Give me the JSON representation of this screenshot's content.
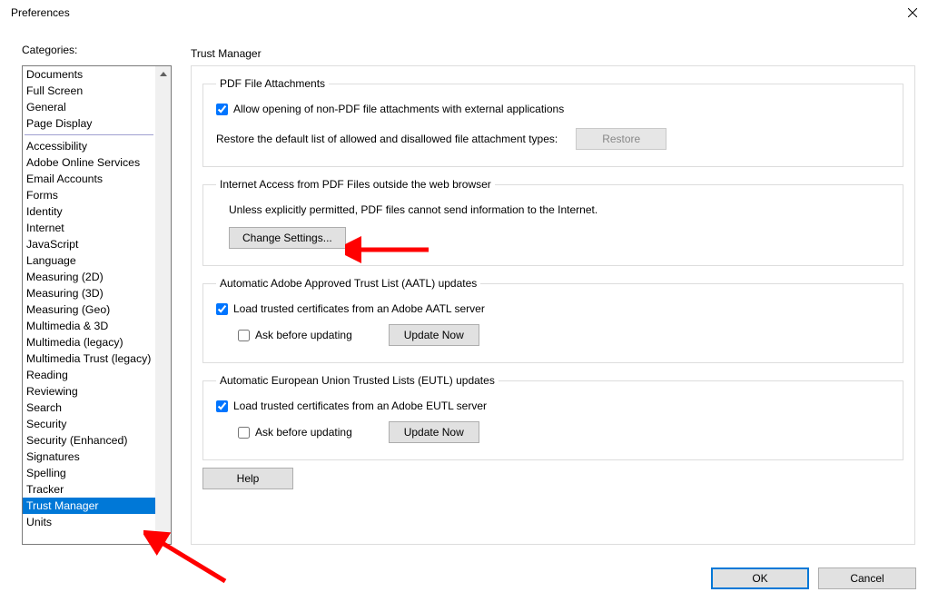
{
  "window": {
    "title": "Preferences"
  },
  "sidebar": {
    "label": "Categories:",
    "group1": [
      "Documents",
      "Full Screen",
      "General",
      "Page Display"
    ],
    "group2": [
      "Accessibility",
      "Adobe Online Services",
      "Email Accounts",
      "Forms",
      "Identity",
      "Internet",
      "JavaScript",
      "Language",
      "Measuring (2D)",
      "Measuring (3D)",
      "Measuring (Geo)",
      "Multimedia & 3D",
      "Multimedia (legacy)",
      "Multimedia Trust (legacy)",
      "Reading",
      "Reviewing",
      "Search",
      "Security",
      "Security (Enhanced)",
      "Signatures",
      "Spelling",
      "Tracker",
      "Trust Manager",
      "Units"
    ],
    "selected": "Trust Manager"
  },
  "panel": {
    "title": "Trust Manager",
    "pdf_attachments": {
      "legend": "PDF File Attachments",
      "allow_label": "Allow opening of non-PDF file attachments with external applications",
      "allow_checked": true,
      "restore_text": "Restore the default list of allowed and disallowed file attachment types:",
      "restore_btn": "Restore"
    },
    "internet": {
      "legend": "Internet Access from PDF Files outside the web browser",
      "desc": "Unless explicitly permitted, PDF files cannot send information to the Internet.",
      "change_btn": "Change Settings..."
    },
    "aatl": {
      "legend": "Automatic Adobe Approved Trust List (AATL) updates",
      "load_label": "Load trusted certificates from an Adobe AATL server",
      "load_checked": true,
      "ask_label": "Ask before updating",
      "ask_checked": false,
      "update_btn": "Update Now"
    },
    "eutl": {
      "legend": "Automatic European Union Trusted Lists (EUTL) updates",
      "load_label": "Load trusted certificates from an Adobe EUTL server",
      "load_checked": true,
      "ask_label": "Ask before updating",
      "ask_checked": false,
      "update_btn": "Update Now"
    },
    "help_btn": "Help"
  },
  "footer": {
    "ok": "OK",
    "cancel": "Cancel"
  }
}
